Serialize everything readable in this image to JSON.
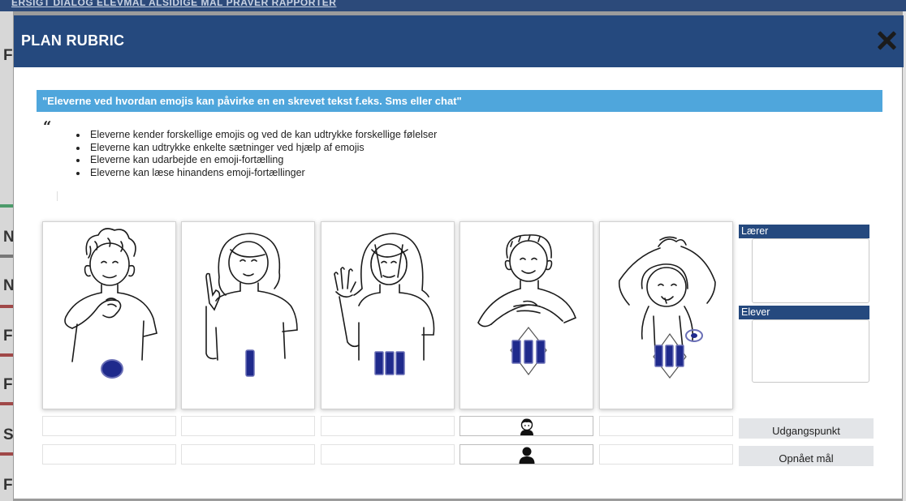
{
  "background": {
    "nav_text": "ERSIGT    DIALOG    ELEVMAL    ALSIDIGE MAL    PRAVER    RAPPORTER",
    "left_letters": [
      "F",
      "N",
      "N",
      "F",
      "F",
      "S",
      "F"
    ]
  },
  "modal": {
    "title": "PLAN RUBRIC",
    "close_icon": "close-icon"
  },
  "goal": {
    "heading": "\"Eleverne ved hvordan emojis kan påvirke en en skrevet tekst f.eks. Sms eller chat\"",
    "quote_mark": "“",
    "bullets": [
      "Eleverne kender forskellige emojis og ved de kan udtrykke forskellige følelser",
      "Eleverne kan udtrykke enkelte sætninger ved hjælp af emojis",
      "Eleverne kan udarbejde en emoji-fortælling",
      "Eleverne kan læse hinandens emoji-fortællinger"
    ]
  },
  "levels": [
    {
      "icon": "level-circle-icon",
      "marker_count": 0
    },
    {
      "icon": "level-one-bar-icon",
      "marker_count": 1
    },
    {
      "icon": "level-three-bars-icon",
      "marker_count": 3
    },
    {
      "icon": "level-three-bars-diamond-icon",
      "marker_count": 3
    },
    {
      "icon": "level-three-bars-diamond-target-icon",
      "marker_count": 3
    }
  ],
  "rows": {
    "udgangspunkt_selected_level": 4,
    "opnaaet_selected_level": 4
  },
  "side_panel": {
    "teacher_label": "Lærer",
    "students_label": "Elever"
  },
  "buttons": {
    "udgangspunkt": "Udgangspunkt",
    "opnaaet": "Opnået mål"
  },
  "colors": {
    "header": "#25497e",
    "goal_bar": "#4fa6dc",
    "marker": "#1f2a8c"
  }
}
